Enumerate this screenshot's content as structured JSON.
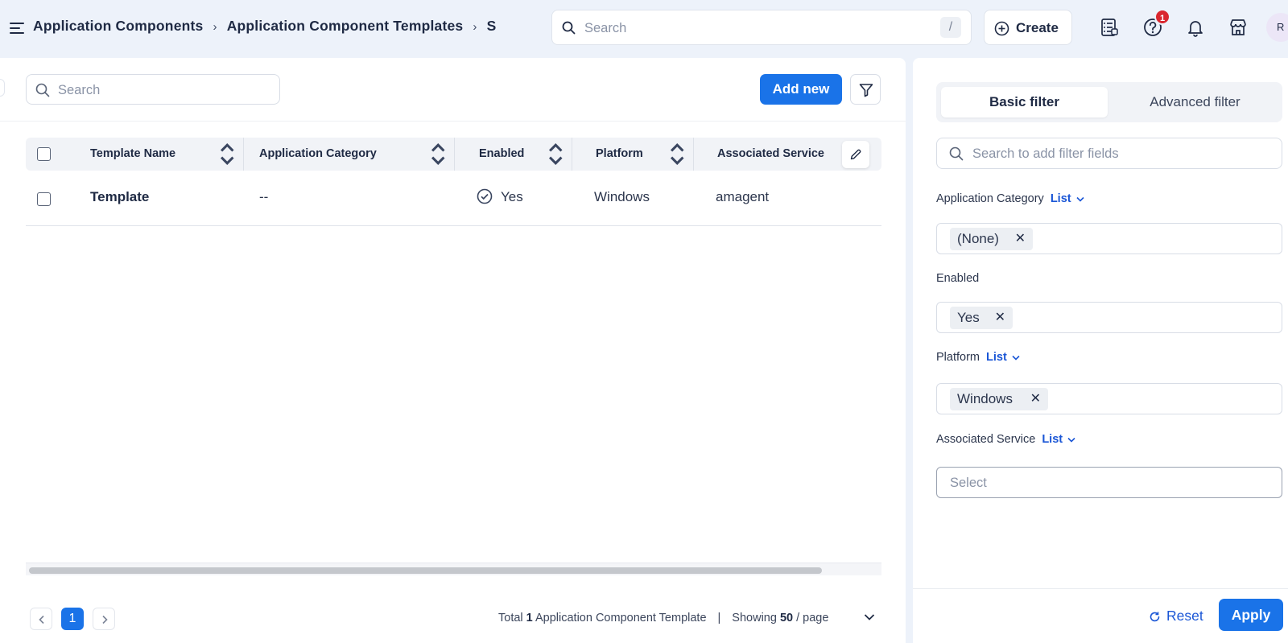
{
  "header": {
    "breadcrumbs": [
      "Application Components",
      "Application Component Templates",
      "S"
    ],
    "search_placeholder": "Search",
    "search_shortcut": "/",
    "create_label": "Create",
    "notification_count": "1",
    "avatar_initial": "R",
    "icons": [
      "menu-icon",
      "search-icon",
      "plus-circle-icon",
      "service-catalog-icon",
      "help-icon",
      "bell-icon",
      "store-icon"
    ]
  },
  "list": {
    "search_placeholder": "Search",
    "add_new_label": "Add new",
    "columns": [
      "Template Name",
      "Application Category",
      "Enabled",
      "Platform",
      "Associated Service"
    ],
    "rows": [
      {
        "template_name": "Template",
        "application_category": "--",
        "enabled": "Yes",
        "platform": "Windows",
        "associated_service": "amagent"
      }
    ],
    "pagination": {
      "current_page": "1",
      "total_prefix": "Total",
      "total_count": "1",
      "total_suffix": "Application Component Template",
      "showing_label": "Showing",
      "page_size": "50",
      "per_page_label": "/ page"
    }
  },
  "filter_panel": {
    "tabs": [
      "Basic filter",
      "Advanced filter"
    ],
    "active_tab": "Basic filter",
    "search_placeholder": "Search to add filter fields",
    "fields": [
      {
        "label": "Application Category",
        "mode": "List",
        "chips": [
          "(None)"
        ]
      },
      {
        "label": "Enabled",
        "mode": "",
        "chips": [
          "Yes"
        ]
      },
      {
        "label": "Platform",
        "mode": "List",
        "chips": [
          "Windows"
        ]
      },
      {
        "label": "Associated Service",
        "mode": "List",
        "placeholder": "Select"
      }
    ],
    "reset_label": "Reset",
    "apply_label": "Apply"
  },
  "colors": {
    "primary": "#1a73e8",
    "link": "#1a56d6",
    "badge": "#d9262e",
    "page_bg": "#edf2fa"
  }
}
